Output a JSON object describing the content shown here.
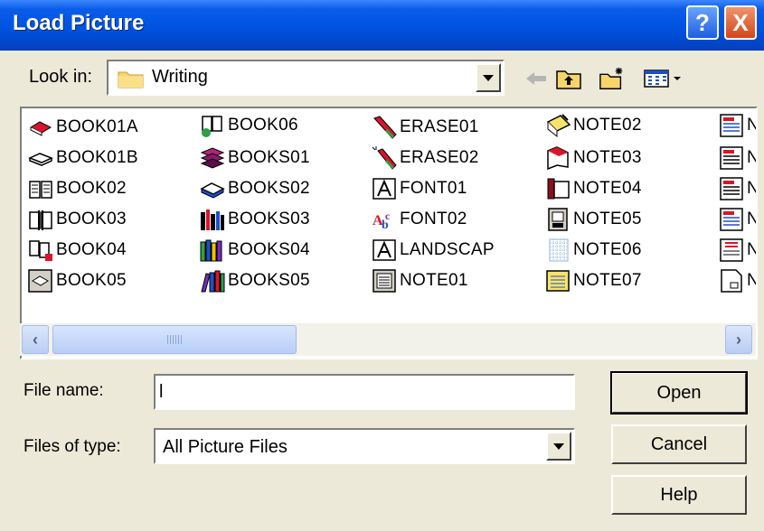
{
  "window": {
    "title": "Load Picture",
    "help_button": "?",
    "close_button": "X"
  },
  "look_in": {
    "label": "Look in:",
    "value": "Writing"
  },
  "toolbar": {
    "icons": [
      "back-arrow-icon",
      "up-one-level-icon",
      "create-new-folder-icon",
      "view-menu-icon"
    ]
  },
  "files": [
    {
      "name": "BOOK01A",
      "icon": "book-red-icon"
    },
    {
      "name": "BOOK01B",
      "icon": "book-open-outline-icon"
    },
    {
      "name": "BOOK02",
      "icon": "book-open-icon"
    },
    {
      "name": "BOOK03",
      "icon": "book-bookmark-icon"
    },
    {
      "name": "BOOK04",
      "icon": "book-open-red-icon"
    },
    {
      "name": "BOOK05",
      "icon": "book-framed-icon"
    },
    {
      "name": "BOOK06",
      "icon": "book-green-icon"
    },
    {
      "name": "BOOKS01",
      "icon": "books-stack-purple-icon"
    },
    {
      "name": "BOOKS02",
      "icon": "book-open-blue-icon"
    },
    {
      "name": "BOOKS03",
      "icon": "books-shelf-icon"
    },
    {
      "name": "BOOKS04",
      "icon": "books-row-color-icon"
    },
    {
      "name": "BOOKS05",
      "icon": "books-leaning-icon"
    },
    {
      "name": "ERASE01",
      "icon": "pencil-eraser-icon"
    },
    {
      "name": "ERASE02",
      "icon": "pencil-eraser-sparkle-icon"
    },
    {
      "name": "FONT01",
      "icon": "font-a-box-icon"
    },
    {
      "name": "FONT02",
      "icon": "font-abc-icon"
    },
    {
      "name": "LANDSCAP",
      "icon": "font-landscape-icon"
    },
    {
      "name": "NOTE01",
      "icon": "notepad-icon"
    },
    {
      "name": "NOTE02",
      "icon": "note-pen-icon"
    },
    {
      "name": "NOTE03",
      "icon": "note-red-icon"
    },
    {
      "name": "NOTE04",
      "icon": "note-book-red-icon"
    },
    {
      "name": "NOTE05",
      "icon": "note-spiral-icon"
    },
    {
      "name": "NOTE06",
      "icon": "note-grid-icon"
    },
    {
      "name": "NOTE07",
      "icon": "note-yellow-icon"
    },
    {
      "name": "N",
      "icon": "memo-icon"
    },
    {
      "name": "N",
      "icon": "memo-icon"
    },
    {
      "name": "N",
      "icon": "memo-icon"
    },
    {
      "name": "N",
      "icon": "memo-icon"
    },
    {
      "name": "N",
      "icon": "memo-red-icon"
    },
    {
      "name": "N",
      "icon": "page-icon"
    }
  ],
  "file_name": {
    "label": "File name:",
    "value": "l"
  },
  "files_of_type": {
    "label": "Files of type:",
    "value": "All Picture Files"
  },
  "buttons": {
    "open": "Open",
    "cancel": "Cancel",
    "help": "Help"
  },
  "colors": {
    "title_bar": "#0054e3",
    "dialog_bg": "#ece9d8"
  }
}
